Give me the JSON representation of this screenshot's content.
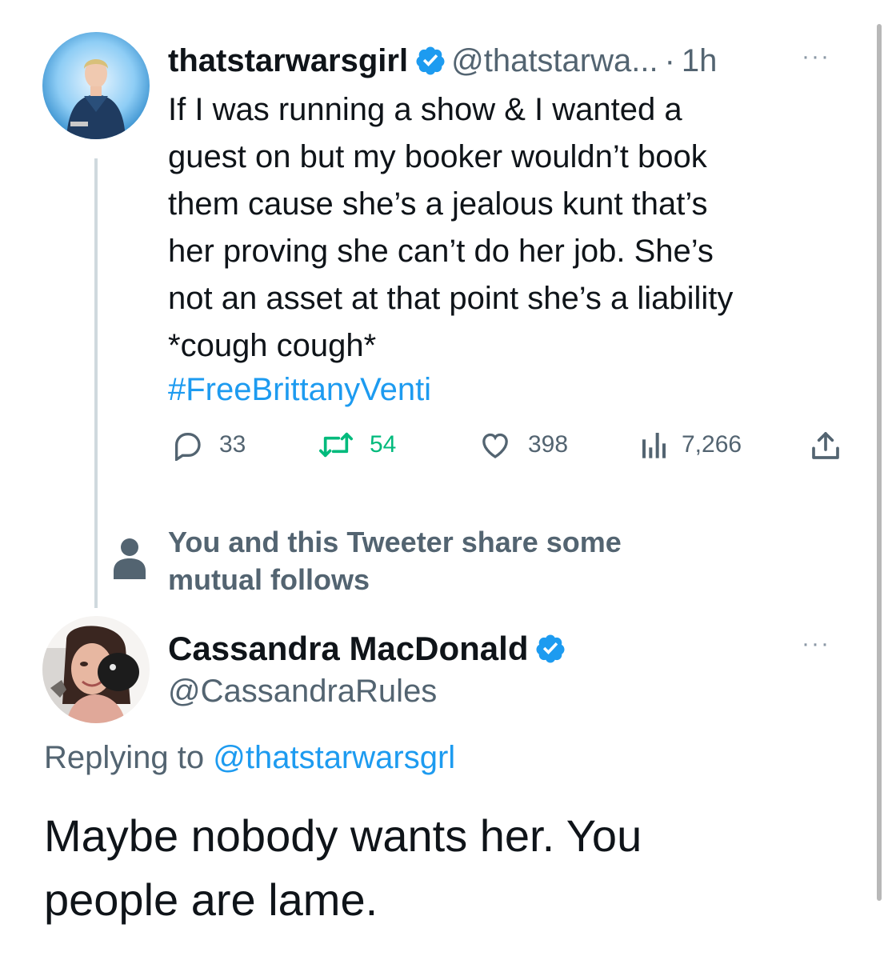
{
  "tweet": {
    "author_name": "thatstarwarsgirl",
    "author_handle": "@thatstarwa...",
    "separator": "·",
    "time": "1h",
    "more_glyph": "···",
    "text_lines": [
      "If I was running a show & I wanted a",
      "guest on but my booker wouldn’t book",
      "them cause she’s a jealous kunt that’s",
      "her proving she can’t do her job. She’s",
      "not an asset at that point she’s a liability",
      "*cough cough*"
    ],
    "hashtag": "#FreeBrittanyVenti",
    "stats": {
      "replies": "33",
      "retweets": "54",
      "likes": "398",
      "views": "7,266"
    },
    "icons": [
      "reply-icon",
      "retweet-icon",
      "like-icon",
      "views-icon",
      "share-icon",
      "verified-badge-icon",
      "more-icon"
    ]
  },
  "notice": {
    "line1": "You and this Tweeter share some",
    "line2": "mutual follows",
    "icon": "person-icon"
  },
  "reply": {
    "author_name": "Cassandra MacDonald",
    "author_handle": "@CassandraRules",
    "more_glyph": "···",
    "replying_prefix": "Replying to",
    "replying_handle": "@thatstarwarsgrl",
    "text_lines": [
      "Maybe nobody wants her. You",
      "people are lame."
    ]
  },
  "colors": {
    "text": "#0f1419",
    "secondary": "#536471",
    "link": "#1d9bf0",
    "retweet_active": "#00ba7c",
    "thread_line": "#cfd9de",
    "verified": "#1d9bf0"
  }
}
